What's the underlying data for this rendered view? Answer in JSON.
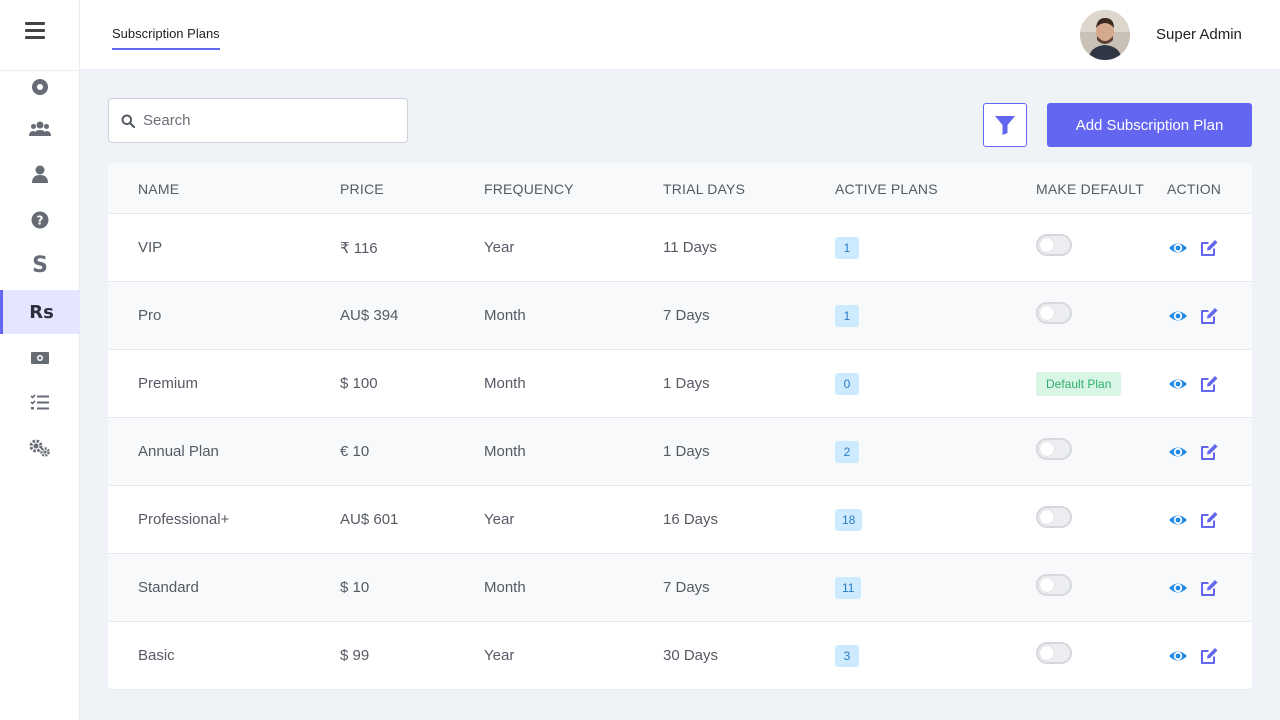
{
  "header": {
    "tab_label": "Subscription Plans",
    "user_name": "Super Admin"
  },
  "sidebar": {
    "items": [
      {
        "name": "sidebar-item-dashboard",
        "icon": "circle-dot-icon"
      },
      {
        "name": "sidebar-item-users-group",
        "icon": "users-icon"
      },
      {
        "name": "sidebar-item-user",
        "icon": "user-icon"
      },
      {
        "name": "sidebar-item-help",
        "icon": "question-circle-icon"
      },
      {
        "name": "sidebar-item-dollar",
        "icon": "dollar-icon",
        "glyph": "S"
      },
      {
        "name": "sidebar-item-rupee",
        "icon": "rupee-icon",
        "glyph": "Rs",
        "active": true
      },
      {
        "name": "sidebar-item-money",
        "icon": "money-bill-icon"
      },
      {
        "name": "sidebar-item-tasks",
        "icon": "task-list-icon"
      },
      {
        "name": "sidebar-item-settings",
        "icon": "gears-icon"
      }
    ]
  },
  "toolbar": {
    "search_placeholder": "Search",
    "add_label": "Add Subscription Plan"
  },
  "table": {
    "columns": [
      "NAME",
      "PRICE",
      "FREQUENCY",
      "TRIAL DAYS",
      "ACTIVE PLANS",
      "MAKE DEFAULT",
      "ACTION"
    ],
    "rows": [
      {
        "name": "VIP",
        "price": "₹ 116",
        "frequency": "Year",
        "trial": "11 Days",
        "active": "1",
        "default": false
      },
      {
        "name": "Pro",
        "price": "AU$ 394",
        "frequency": "Month",
        "trial": "7 Days",
        "active": "1",
        "default": false
      },
      {
        "name": "Premium",
        "price": "$ 100",
        "frequency": "Month",
        "trial": "1 Days",
        "active": "0",
        "default": true
      },
      {
        "name": "Annual Plan",
        "price": "€ 10",
        "frequency": "Month",
        "trial": "1 Days",
        "active": "2",
        "default": false
      },
      {
        "name": "Professional+",
        "price": "AU$ 601",
        "frequency": "Year",
        "trial": "16 Days",
        "active": "18",
        "default": false
      },
      {
        "name": "Standard",
        "price": "$ 10",
        "frequency": "Month",
        "trial": "7 Days",
        "active": "11",
        "default": false
      },
      {
        "name": "Basic",
        "price": "$ 99",
        "frequency": "Year",
        "trial": "30 Days",
        "active": "3",
        "default": false
      }
    ],
    "default_tag_label": "Default Plan"
  },
  "colors": {
    "accent": "#6366f1",
    "view_icon": "#1e88e5",
    "badge_bg": "#cdeafe",
    "default_tag_bg": "#d9f5e6"
  }
}
